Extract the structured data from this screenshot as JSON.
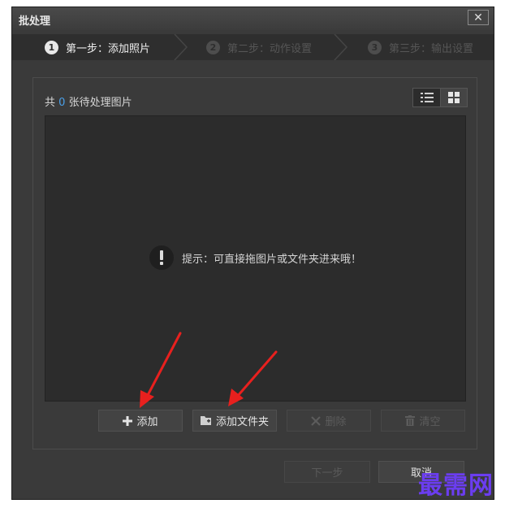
{
  "window": {
    "title": "批处理",
    "close_glyph": "✕"
  },
  "steps": [
    {
      "number": "1",
      "label": "第一步：添加照片",
      "active": true
    },
    {
      "number": "2",
      "label": "第二步：动作设置",
      "active": false
    },
    {
      "number": "3",
      "label": "第三步：输出设置",
      "active": false
    }
  ],
  "panel": {
    "count_prefix": "共",
    "count_value": "0",
    "count_suffix": "张待处理图片",
    "view_modes": [
      "list-view-icon",
      "grid-view-icon"
    ],
    "hint_text": "提示：可直接拖图片或文件夹进来哦！",
    "hint_icon": "exclamation-icon"
  },
  "actions": {
    "add_label": "添加",
    "add_folder_label": "添加文件夹",
    "delete_label": "删除",
    "clear_label": "清空"
  },
  "footer": {
    "next_label": "下一步",
    "cancel_label": "取消"
  },
  "watermark": "最需网",
  "colors": {
    "dialog_bg": "#3a3a3a",
    "drop_area_bg": "#2c2c2c",
    "accent_count": "#4aa0e8",
    "annotation_arrow": "#e8201e",
    "watermark": "#6b3df0"
  }
}
